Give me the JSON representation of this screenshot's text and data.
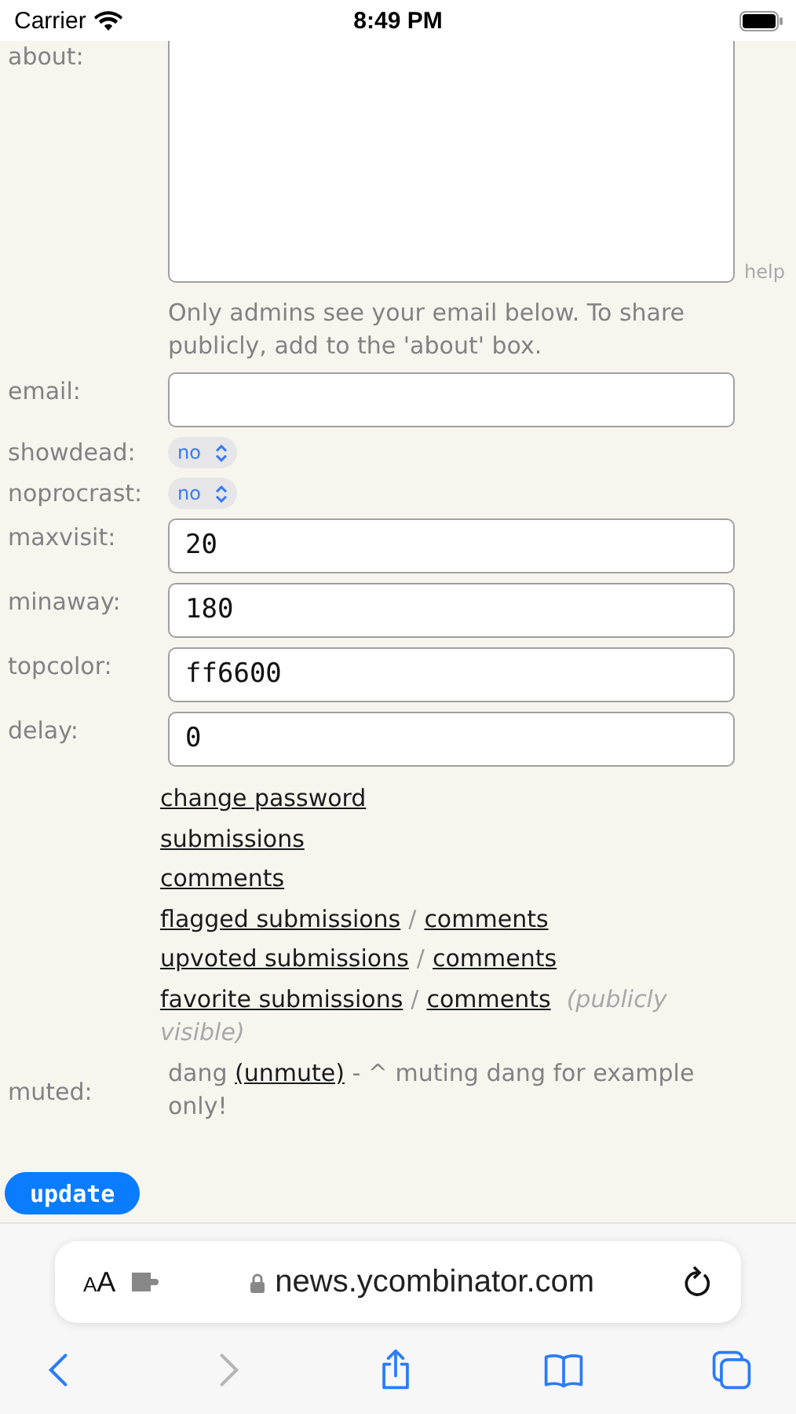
{
  "status_bar": {
    "carrier": "Carrier",
    "time": "8:49 PM"
  },
  "form": {
    "rows": [
      {
        "kind": "textarea",
        "label": "about:",
        "help": "help"
      },
      {
        "kind": "note",
        "text": "Only admins see your email below. To share publicly, add to the 'about' box."
      },
      {
        "kind": "input",
        "label": "email:"
      },
      {
        "kind": "select",
        "label": "showdead:",
        "value": "no"
      },
      {
        "kind": "select",
        "label": "noprocrast:",
        "value": "no"
      },
      {
        "kind": "input",
        "label": "maxvisit:",
        "value": "20"
      },
      {
        "kind": "input",
        "label": "minaway:",
        "value": "180"
      },
      {
        "kind": "input",
        "label": "topcolor:",
        "value": "ff6600"
      },
      {
        "kind": "input",
        "label": "delay:",
        "value": "0"
      }
    ],
    "links": [
      {
        "items": [
          "change password"
        ]
      },
      {
        "items": [
          "submissions"
        ]
      },
      {
        "items": [
          "comments"
        ]
      },
      {
        "items": [
          "flagged submissions",
          "comments"
        ],
        "separator": "/"
      },
      {
        "items": [
          "upvoted submissions",
          "comments"
        ],
        "separator": "/"
      },
      {
        "items": [
          "favorite submissions",
          "comments"
        ],
        "separator": "/",
        "note": "(publicly visible)"
      }
    ],
    "muted": {
      "label": "muted:",
      "user": "dang",
      "link": "(unmute)",
      "note": "- ^ muting dang for example only!"
    },
    "submit": "update"
  },
  "browser": {
    "reader_label": "AA",
    "url": "news.ycombinator.com",
    "toolbar": [
      {
        "kind": "back",
        "disabled": false
      },
      {
        "kind": "forward",
        "disabled": true
      },
      {
        "kind": "share",
        "disabled": false
      },
      {
        "kind": "bookmarks",
        "disabled": false
      },
      {
        "kind": "tabs",
        "disabled": false
      }
    ]
  }
}
